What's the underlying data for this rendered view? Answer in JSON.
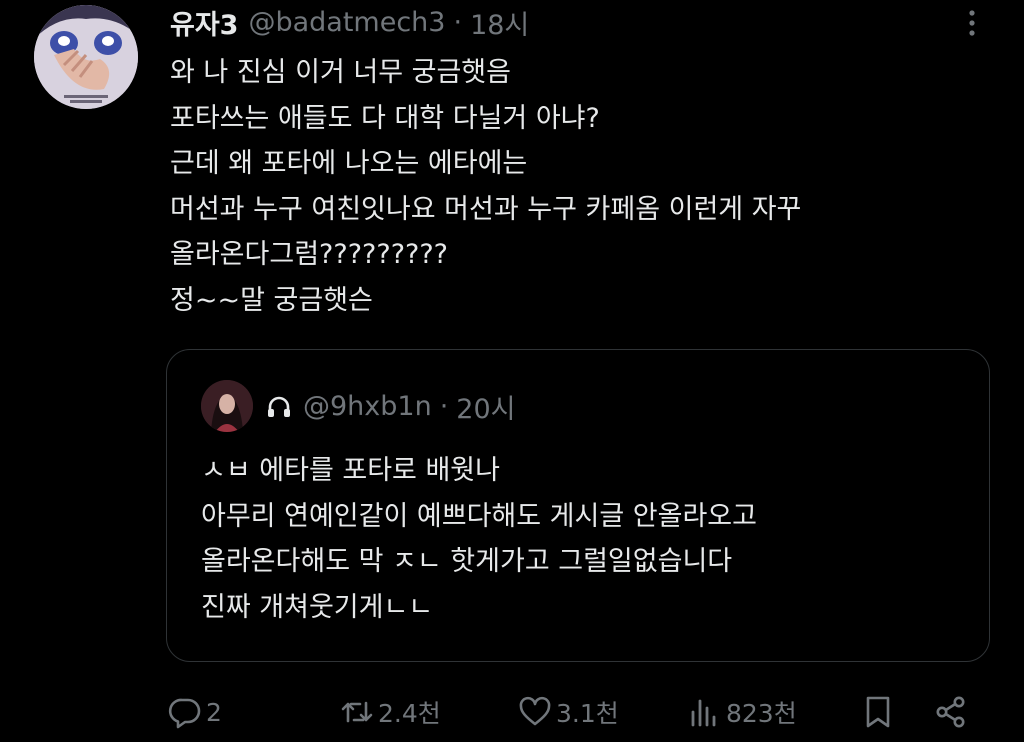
{
  "tweet": {
    "display_name": "유자3",
    "handle": "@badatmech3",
    "separator": "·",
    "time": "18시",
    "text_lines": [
      "와 나 진심 이거 너무 궁금햇음",
      "포타쓰는 애들도 다 대학 다닐거 아냐?",
      "근데 왜 포타에 나오는 에타에는",
      "머선과 누구 여친잇나요 머선과 누구 카페옴 이런게 자꾸",
      "올라온다그럼?????????",
      "정~~말 궁금햇슨"
    ]
  },
  "quote": {
    "handle": "@9hxb1n",
    "separator": "·",
    "time": "20시",
    "protected_icon": "lock-icon",
    "text_lines": [
      "ㅅㅂ 에타를 포타로 배웟나",
      "아무리 연예인같이 예쁘다해도 게시글 안올라오고",
      "올라온다해도 막 ㅈㄴ 핫게가고 그럴일없습니다",
      "진짜 개쳐웃기게ㄴㄴ"
    ]
  },
  "actions": {
    "reply": {
      "icon": "reply-icon",
      "count": "2"
    },
    "retweet": {
      "icon": "retweet-icon",
      "count": "2.4천"
    },
    "like": {
      "icon": "heart-icon",
      "count": "3.1천"
    },
    "views": {
      "icon": "views-icon",
      "count": "823천"
    },
    "bookmark": {
      "icon": "bookmark-icon"
    },
    "share": {
      "icon": "share-icon"
    }
  },
  "colors": {
    "background": "#000000",
    "text_primary": "#e7e9ea",
    "text_secondary": "#71767b",
    "border": "#2f3336"
  }
}
